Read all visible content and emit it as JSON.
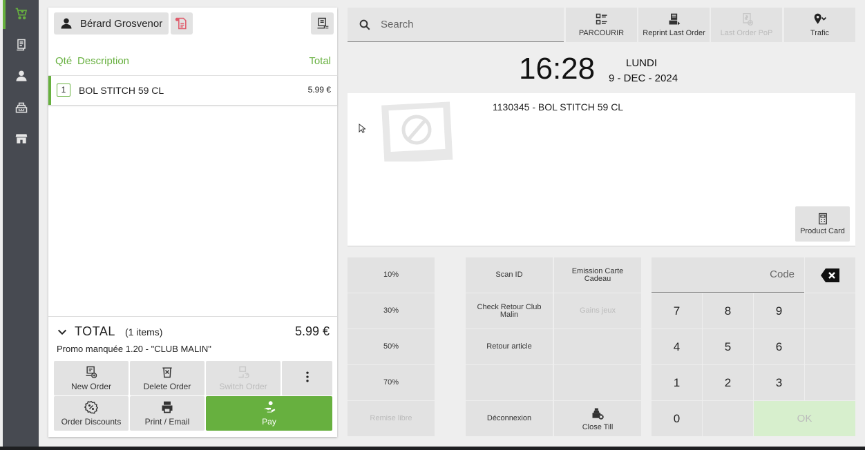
{
  "colors": {
    "accent": "#67b03f",
    "sidebar": "#474a51",
    "button": "#e2e2e2",
    "ok_disabled": "#d7efcd"
  },
  "sidebar": {
    "items": [
      {
        "icon": "cart-icon",
        "active": true
      },
      {
        "icon": "receipt-icon",
        "active": false
      },
      {
        "icon": "user-icon",
        "active": false
      },
      {
        "icon": "cash-register-icon",
        "active": false
      },
      {
        "icon": "store-icon",
        "active": false
      }
    ]
  },
  "order": {
    "customer_name": "Bérard Grosvenor",
    "columns": {
      "qty": "Qté",
      "description": "Description",
      "total": "Total"
    },
    "lines": [
      {
        "qty": "1",
        "description": "BOL STITCH 59 CL",
        "total": "5.99 €"
      }
    ],
    "total_label": "TOTAL",
    "total_items": "(1 items)",
    "total_value": "5.99 €",
    "promo": "Promo manquée 1.20 - \"CLUB MALIN\"",
    "actions": {
      "new_order": "New Order",
      "delete_order": "Delete Order",
      "switch_order": "Switch Order",
      "order_discounts": "Order Discounts",
      "print_email": "Print / Email",
      "pay": "Pay"
    }
  },
  "topbar": {
    "search_placeholder": "Search",
    "browse": "PARCOURIR",
    "reprint": "Reprint Last Order",
    "last_pop": "Last Order PoP",
    "traffic": "Trafic"
  },
  "clock": {
    "time": "16:28",
    "day": "LUNDI",
    "date": "9 - DEC - 2024"
  },
  "product": {
    "title": "1130345 - BOL STITCH 59 CL",
    "card_label": "Product Card"
  },
  "discounts": {
    "d10": "10%",
    "d30": "30%",
    "d50": "50%",
    "d70": "70%",
    "free": "Remise libre"
  },
  "functions": {
    "scan_id": "Scan ID",
    "gift_card": "Emission Carte Cadeau",
    "check_return": "Check Retour Club Malin",
    "games": "Gains jeux",
    "return_item": "Retour article",
    "logout": "Déconnexion",
    "close_till": "Close Till"
  },
  "keypad": {
    "code_placeholder": "Code",
    "keys": [
      "7",
      "8",
      "9",
      "4",
      "5",
      "6",
      "1",
      "2",
      "3",
      "0"
    ],
    "ok": "OK"
  }
}
